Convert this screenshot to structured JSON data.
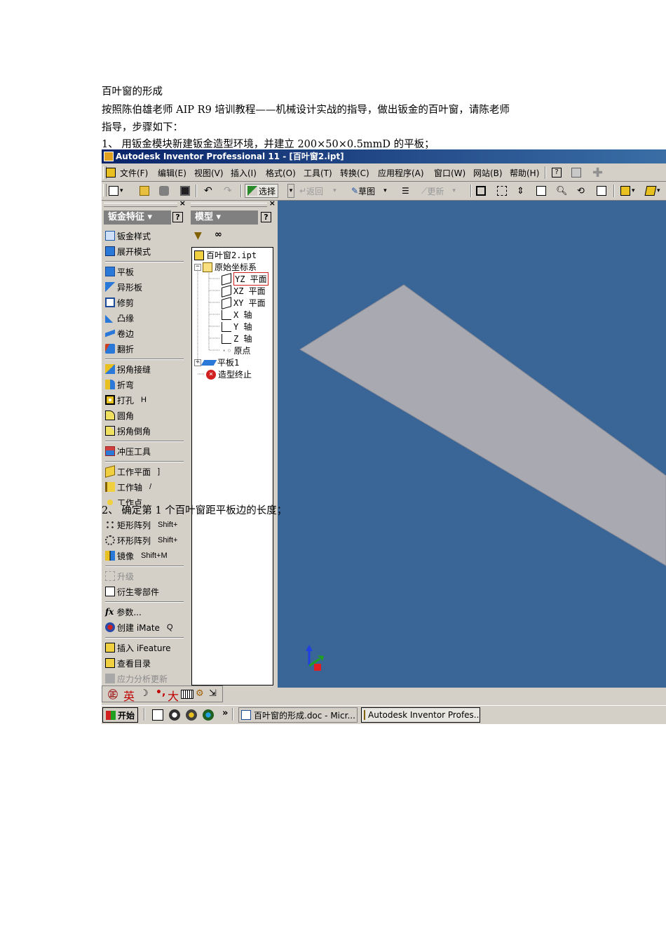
{
  "document": {
    "title": "百叶窗的形成",
    "para1": "按照陈伯雄老师 AIP R9 培训教程——机械设计实战的指导，做出钣金的百叶窗，请陈老师",
    "para2": "指导，步骤如下：",
    "step1": "1、 用钣金模块新建钣金造型环境，并建立 200×50×0.5mmD 的平板；",
    "step2": "2、 确定第 1 个百叶窗距平板边的长度；"
  },
  "window": {
    "title": "Autodesk Inventor Professional 11 - [百叶窗2.ipt]"
  },
  "menu": [
    "文件(F)",
    "编辑(E)",
    "视图(V)",
    "插入(I)",
    "格式(O)",
    "工具(T)",
    "转换(C)",
    "应用程序(A)",
    "窗口(W)",
    "网站(B)",
    "帮助(H)"
  ],
  "toolbar": {
    "select_label": "选择",
    "return_label": "返回",
    "sketch_label": "草图",
    "update_label": "更新"
  },
  "panel_bar": {
    "title": "钣金特征 ▾",
    "help": "?",
    "items": [
      {
        "label": "钣金样式",
        "shortcut": ""
      },
      {
        "label": "展开模式",
        "shortcut": ""
      },
      {
        "label": "平板",
        "shortcut": ""
      },
      {
        "label": "异形板",
        "shortcut": ""
      },
      {
        "label": "修剪",
        "shortcut": ""
      },
      {
        "label": "凸缘",
        "shortcut": ""
      },
      {
        "label": "卷边",
        "shortcut": ""
      },
      {
        "label": "翻折",
        "shortcut": ""
      },
      {
        "label": "拐角接缝",
        "shortcut": ""
      },
      {
        "label": "折弯",
        "shortcut": ""
      },
      {
        "label": "打孔",
        "shortcut": "H"
      },
      {
        "label": "圆角",
        "shortcut": ""
      },
      {
        "label": "拐角倒角",
        "shortcut": ""
      },
      {
        "label": "冲压工具",
        "shortcut": ""
      },
      {
        "label": "工作平面",
        "shortcut": "]"
      },
      {
        "label": "工作轴",
        "shortcut": "/"
      },
      {
        "label": "工作点",
        "shortcut": ""
      },
      {
        "label": "矩形阵列",
        "shortcut": "Shift+"
      },
      {
        "label": "环形阵列",
        "shortcut": "Shift+"
      },
      {
        "label": "镜像",
        "shortcut": "Shift+M"
      },
      {
        "label": "升级",
        "shortcut": ""
      },
      {
        "label": "衍生零部件",
        "shortcut": ""
      },
      {
        "label": "参数...",
        "shortcut": ""
      },
      {
        "label": "创建 iMate",
        "shortcut": "Q"
      },
      {
        "label": "插入 iFeature",
        "shortcut": ""
      },
      {
        "label": "查看目录",
        "shortcut": ""
      },
      {
        "label": "应力分析更新",
        "shortcut": ""
      }
    ]
  },
  "model_browser": {
    "title": "模型 ▾",
    "help": "?",
    "tree": {
      "root": "百叶窗2.ipt",
      "origin": "原始坐标系",
      "yz": "YZ 平面",
      "xz": "XZ 平面",
      "xy": "XY 平面",
      "xaxis": "X 轴",
      "yaxis": "Y 轴",
      "zaxis": "Z 轴",
      "point": "原点",
      "face": "平板1",
      "end": "造型终止"
    }
  },
  "language_bar": {
    "lang": "英",
    "size": "大"
  },
  "taskbar": {
    "start": "开始",
    "more": "»",
    "tasks": [
      "百叶窗的形成.doc - Micr...",
      "Autodesk Inventor Profes..."
    ]
  },
  "colors": {
    "titlebar": "#0a246a",
    "viewport": "#3a6597",
    "plate": "#a9a9b1"
  }
}
